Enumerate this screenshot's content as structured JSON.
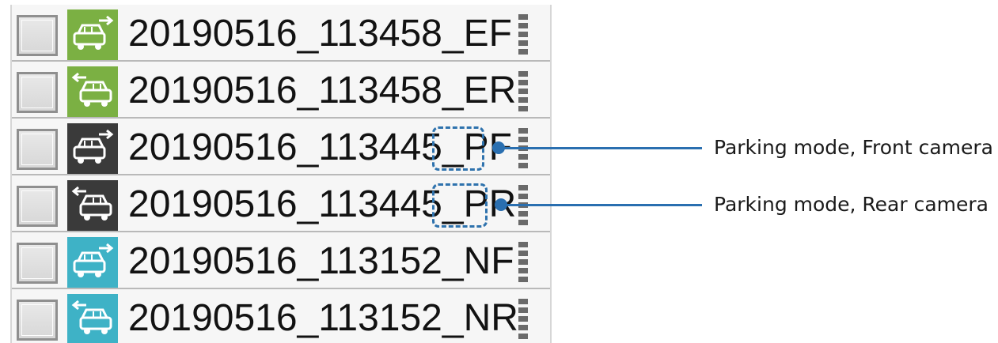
{
  "files": [
    {
      "name": "20190516_113458_EF",
      "tile_color": "#7bb043",
      "direction": "front",
      "icon": "car-front-arrow-icon"
    },
    {
      "name": "20190516_113458_ER",
      "tile_color": "#7bb043",
      "direction": "rear",
      "icon": "car-rear-arrow-icon"
    },
    {
      "name": "20190516_113445_PF",
      "tile_color": "#3a3a3a",
      "direction": "front",
      "icon": "car-front-arrow-icon"
    },
    {
      "name": "20190516_113445_PR",
      "tile_color": "#3a3a3a",
      "direction": "rear",
      "icon": "car-rear-arrow-icon"
    },
    {
      "name": "20190516_113152_NF",
      "tile_color": "#3eb2c6",
      "direction": "front",
      "icon": "car-front-arrow-icon"
    },
    {
      "name": "20190516_113152_NR",
      "tile_color": "#3eb2c6",
      "direction": "rear",
      "icon": "car-rear-arrow-icon"
    }
  ],
  "callouts": {
    "pf": "Parking mode, Front camera",
    "pr": "Parking mode, Rear camera",
    "accent_color": "#2a6fb0"
  }
}
